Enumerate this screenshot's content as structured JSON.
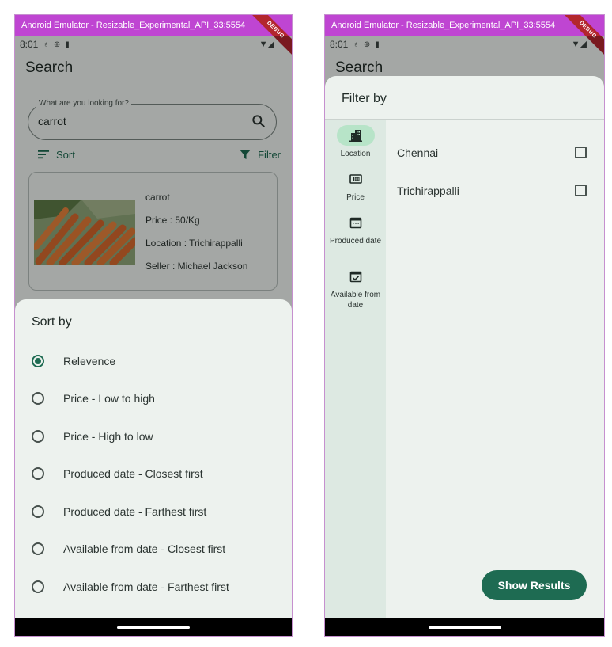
{
  "left_screen": {
    "window_title": "Android Emulator - Resizable_Experimental_API_33:5554",
    "status_time": "8:01",
    "debug_banner": "DEBUG",
    "appbar_title": "Search",
    "search": {
      "label": "What are you looking for?",
      "value": "carrot"
    },
    "toolbar": {
      "sort_label": "Sort",
      "filter_label": "Filter"
    },
    "product": {
      "name": "carrot",
      "price": "Price : 50/Kg",
      "location": "Location : Trichirappalli",
      "seller": "Seller : Michael Jackson"
    },
    "sort_sheet": {
      "title": "Sort by",
      "options": [
        {
          "label": "Relevence",
          "selected": true
        },
        {
          "label": "Price - Low to high",
          "selected": false
        },
        {
          "label": "Price - High to low",
          "selected": false
        },
        {
          "label": "Produced date - Closest first",
          "selected": false
        },
        {
          "label": "Produced date - Farthest first",
          "selected": false
        },
        {
          "label": "Available from date - Closest first",
          "selected": false
        },
        {
          "label": "Available from date - Farthest first",
          "selected": false
        }
      ]
    }
  },
  "right_screen": {
    "window_title": "Android Emulator - Resizable_Experimental_API_33:5554",
    "status_time": "8:01",
    "debug_banner": "DEBUG",
    "appbar_title": "Search",
    "filter_sheet": {
      "title": "Filter by",
      "rail": [
        {
          "label": "Location",
          "icon": "apartment-icon",
          "active": true
        },
        {
          "label": "Price",
          "icon": "price-tag-icon",
          "active": false
        },
        {
          "label": "Produced date",
          "icon": "calendar-icon",
          "active": false
        },
        {
          "label": "Available from date",
          "icon": "calendar-check-icon",
          "active": false
        }
      ],
      "options": [
        {
          "label": "Chennai",
          "checked": false
        },
        {
          "label": "Trichirappalli",
          "checked": false
        }
      ],
      "submit_label": "Show Results"
    }
  },
  "colors": {
    "title_bar": "#bf45d2",
    "primary": "#1e6b52",
    "sheet_bg": "#edf2ee",
    "rail_bg": "#dde9e2",
    "rail_active": "#b7e4c8"
  }
}
